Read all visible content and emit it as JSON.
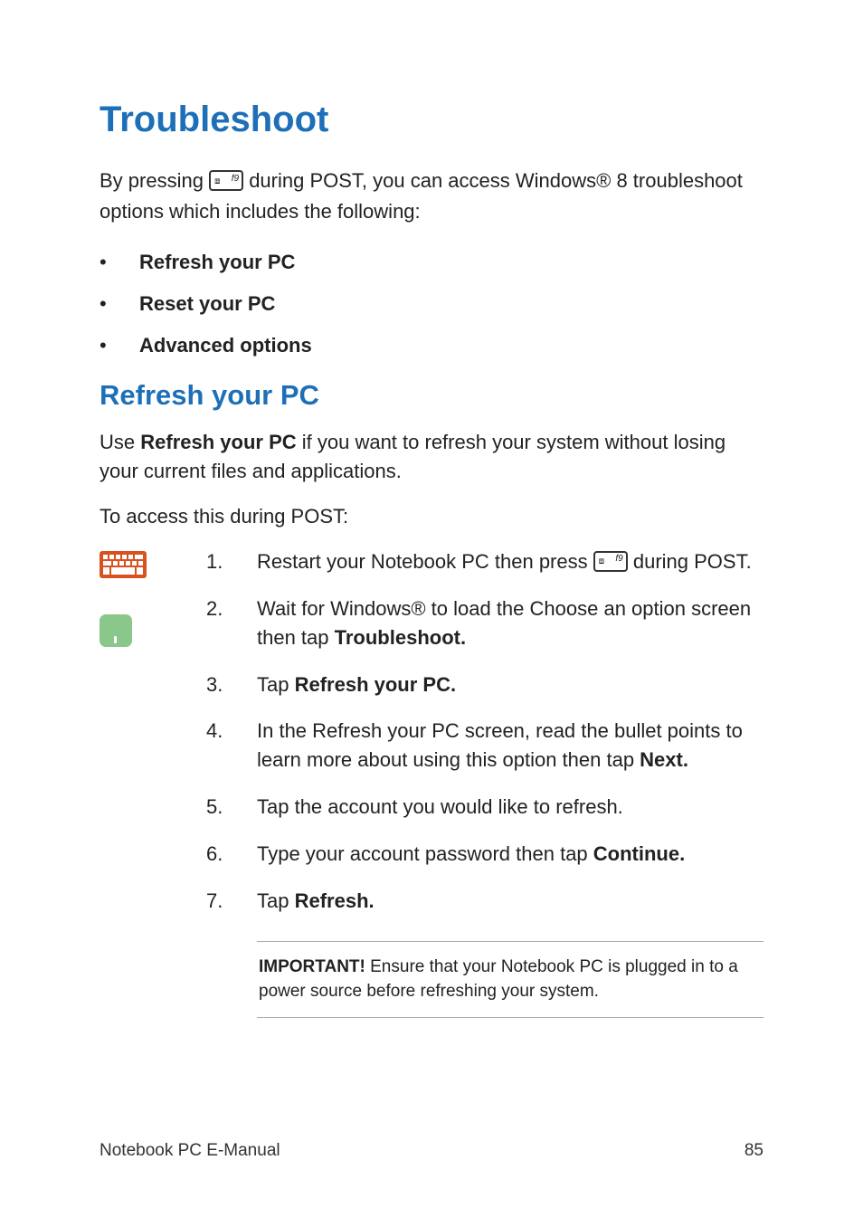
{
  "colors": {
    "heading_blue": "#1d6fb8",
    "keyboard_icon": "#d8521f",
    "touch_icon": "#8AC78A"
  },
  "title": "Troubleshoot",
  "intro_pre": "By pressing ",
  "intro_post": " during POST, you can access Windows® 8 troubleshoot options which includes the following:",
  "key_label": "f9",
  "bullets": {
    "b1": "Refresh your PC",
    "b2": "Reset your PC",
    "b3": "Advanced options"
  },
  "section_heading": "Refresh your PC",
  "section_intro_pre": "Use ",
  "section_intro_bold": "Refresh your PC",
  "section_intro_post": " if you want to refresh your system without losing your current files and applications.",
  "section_subintro": "To access this during POST:",
  "icons": {
    "keyboard": "keyboard-icon",
    "touch": "touch-icon"
  },
  "steps": {
    "s1": {
      "num": "1.",
      "pre": "Restart your Notebook PC then press ",
      "post": " during POST."
    },
    "s2": {
      "num": "2.",
      "pre": "Wait for Windows® to load the Choose an option screen then tap ",
      "bold": "Troubleshoot."
    },
    "s3": {
      "num": "3.",
      "pre": "Tap ",
      "bold": "Refresh your PC."
    },
    "s4": {
      "num": "4.",
      "pre": "In the Refresh your PC screen, read the bullet points to learn more about using this option then tap ",
      "bold": "Next."
    },
    "s5": {
      "num": "5.",
      "text": "Tap the account you would like to refresh."
    },
    "s6": {
      "num": "6.",
      "pre": "Type your account password then tap ",
      "bold": "Continue."
    },
    "s7": {
      "num": "7.",
      "pre": "Tap ",
      "bold": "Refresh."
    }
  },
  "important": {
    "label": "IMPORTANT!",
    "text": " Ensure that your Notebook PC is plugged in to a power source before refreshing your system."
  },
  "footer": {
    "left": "Notebook PC E-Manual",
    "right": "85"
  }
}
